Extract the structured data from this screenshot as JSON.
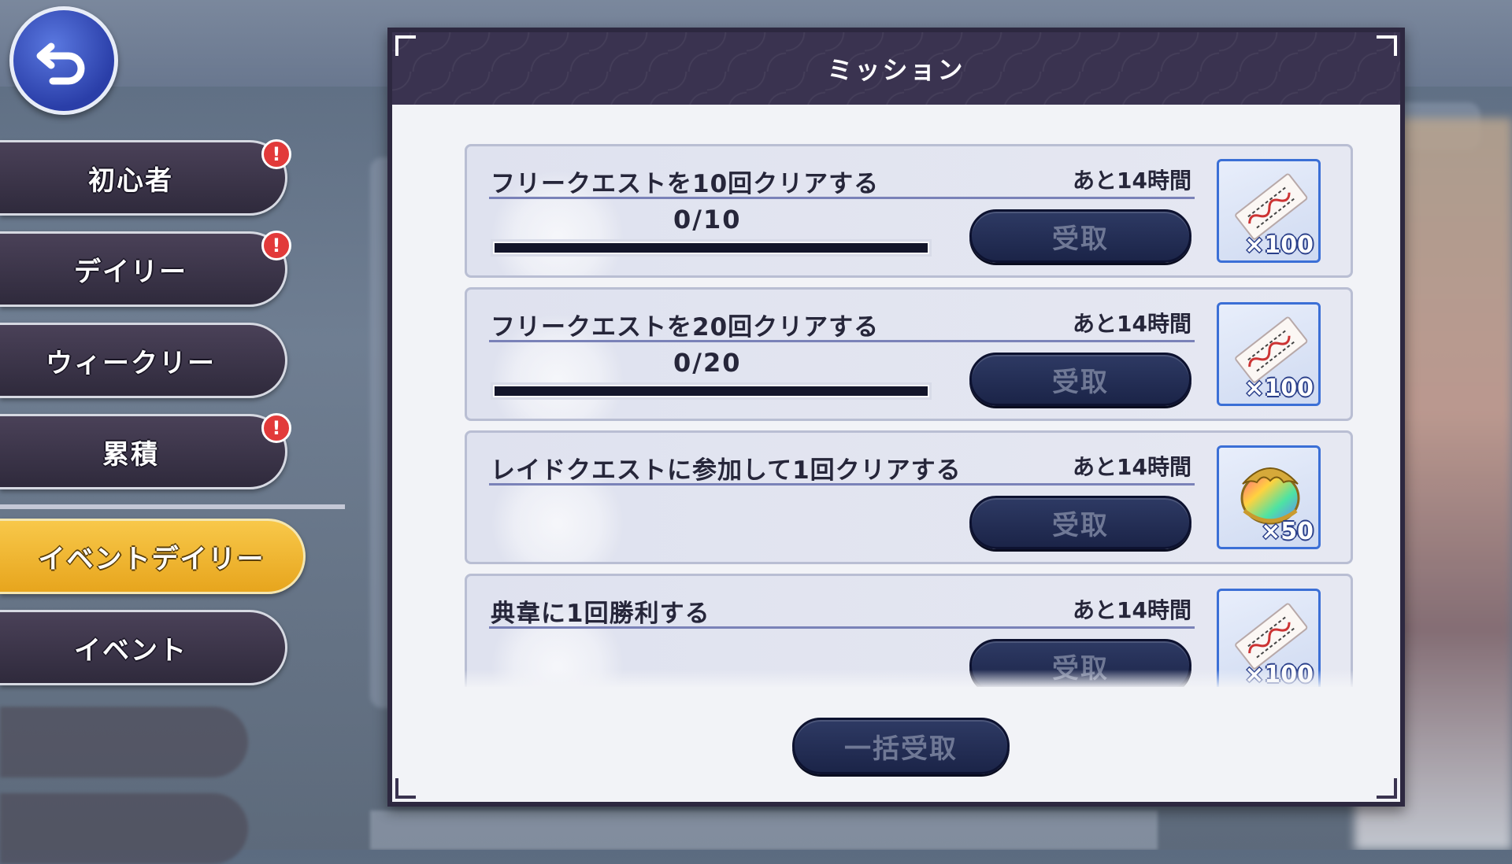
{
  "dialog": {
    "title": "ミッション",
    "bulk_receive_label": "一括受取"
  },
  "tabs": [
    {
      "label": "初心者",
      "badge": "!"
    },
    {
      "label": "デイリー",
      "badge": "!"
    },
    {
      "label": "ウィークリー",
      "badge": ""
    },
    {
      "label": "累積",
      "badge": "!"
    },
    {
      "label": "イベントデイリー",
      "badge": "",
      "active": true
    },
    {
      "label": "イベント",
      "badge": ""
    }
  ],
  "missions": [
    {
      "title": "フリークエストを10回クリアする",
      "time_left": "あと14時間",
      "progress": "0/10",
      "progress_fraction": 0,
      "button": "受取",
      "reward_icon": "ticket-icon",
      "reward_qty": "×100"
    },
    {
      "title": "フリークエストを20回クリアする",
      "time_left": "あと14時間",
      "progress": "0/20",
      "progress_fraction": 0,
      "button": "受取",
      "reward_icon": "ticket-icon",
      "reward_qty": "×100"
    },
    {
      "title": "レイドクエストに参加して1回クリアする",
      "time_left": "あと14時間",
      "button": "受取",
      "reward_icon": "rainbow-gem-icon",
      "reward_qty": "×50"
    },
    {
      "title": "典韋に1回勝利する",
      "time_left": "あと14時間",
      "button": "受取",
      "reward_icon": "ticket-icon",
      "reward_qty": "×100"
    }
  ],
  "colors": {
    "accent": "#f2b52a",
    "header": "#3a3350",
    "button": "#1b2448",
    "badge": "#e23a3a"
  }
}
